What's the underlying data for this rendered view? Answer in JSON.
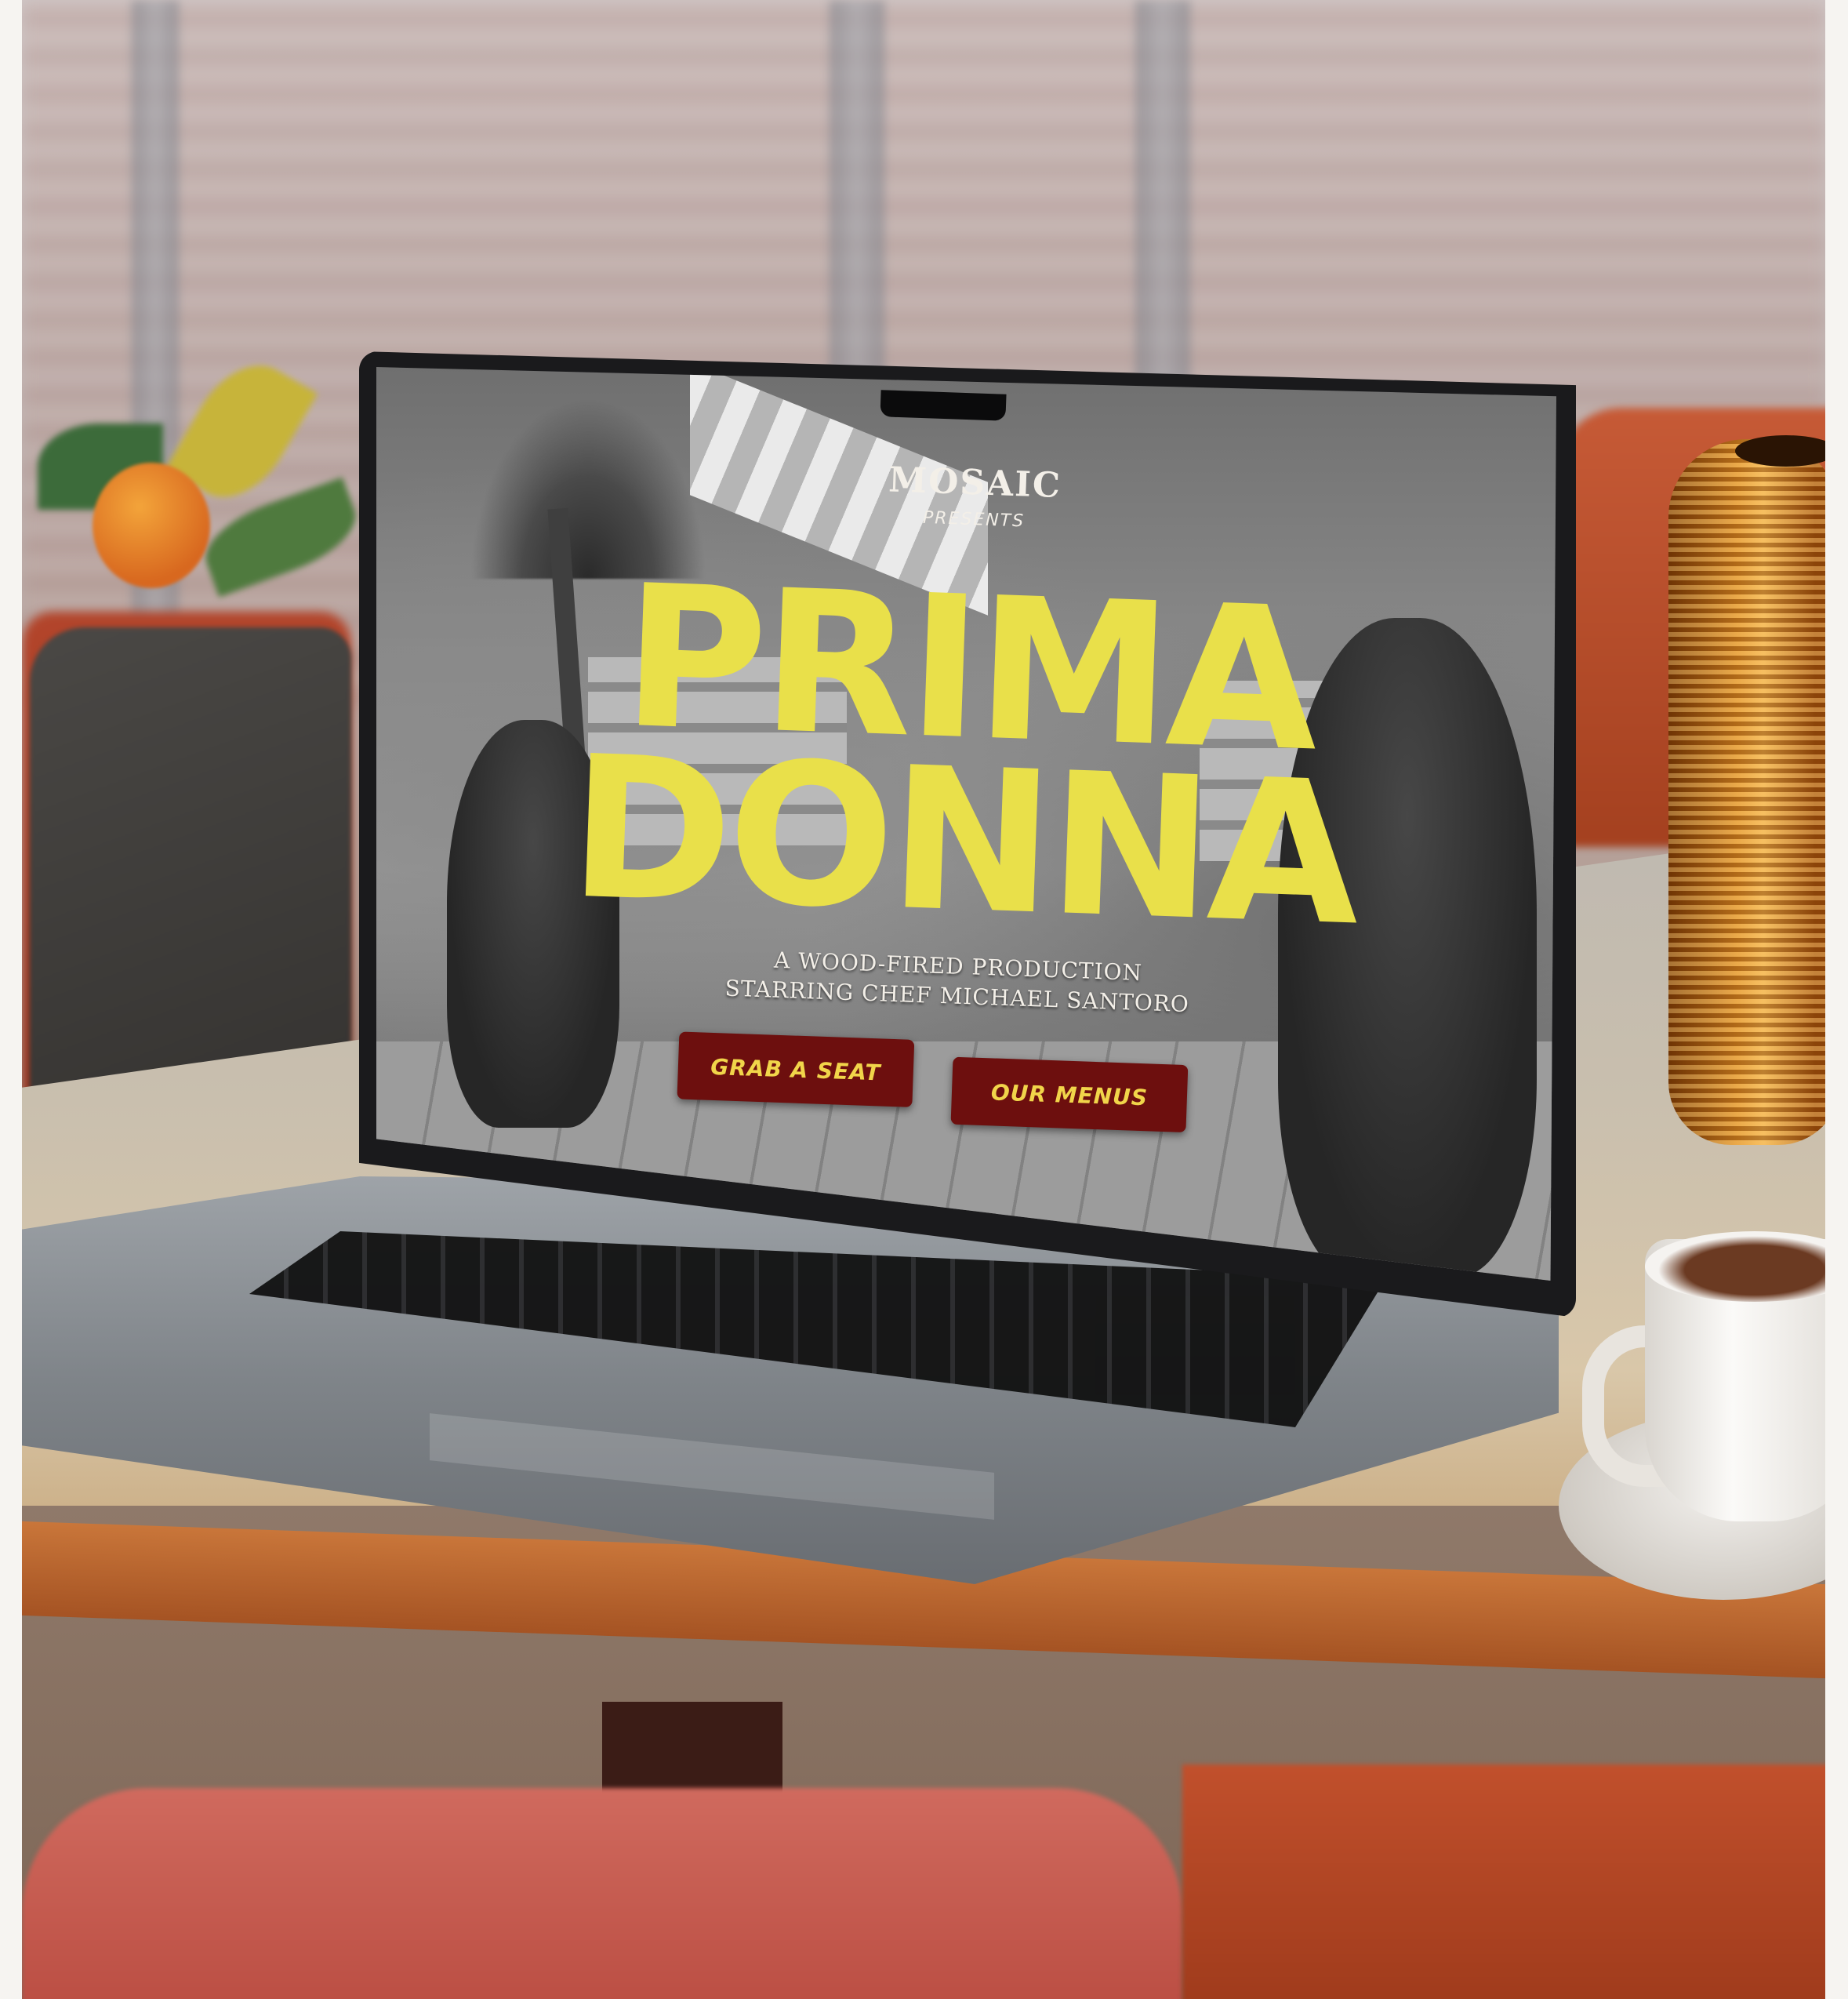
{
  "site": {
    "brand": "MOSAIC",
    "presents": "PRESENTS",
    "title_line1": "PRIMA",
    "title_line2": "DONNA",
    "tagline_line1": "A WOOD-FIRED PRODUCTION",
    "tagline_line2": "STARRING CHEF MICHAEL SANTORO"
  },
  "actions": {
    "grab_seat_label": "GRAB A SEAT",
    "our_menus_label": "OUR MENUS"
  },
  "colors": {
    "title_yellow": "#e9e04a",
    "button_red": "#6d0f0e",
    "button_text": "#f1d54a"
  }
}
